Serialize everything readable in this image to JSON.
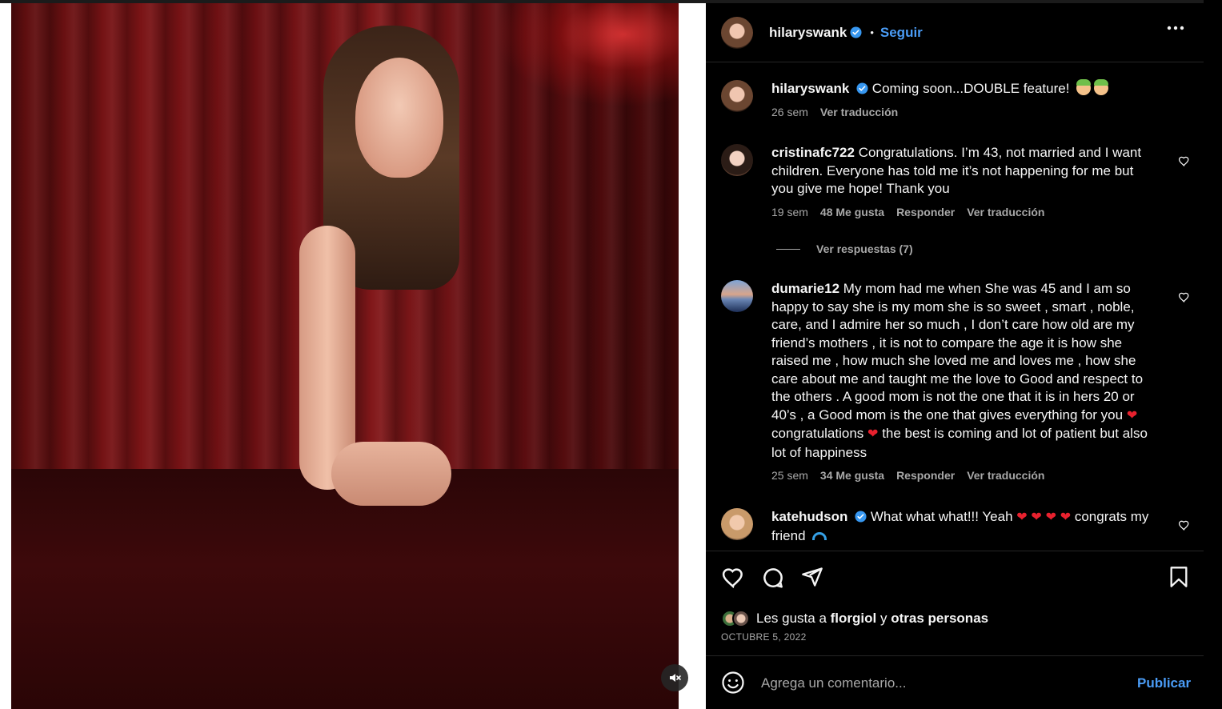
{
  "post": {
    "author": "hilaryswank",
    "follow_label": "Seguir",
    "separator": "•"
  },
  "caption": {
    "username": "hilaryswank",
    "text": "Coming soon...DOUBLE feature!",
    "time": "26 sem",
    "translate": "Ver traducción"
  },
  "comments": [
    {
      "username": "cristinafc722",
      "text": "Congratulations. I’m 43, not married and I want children. Everyone has told me it’s not happening for me but you give me hope! Thank you",
      "time": "19 sem",
      "likes": "48 Me gusta",
      "reply": "Responder",
      "translate": "Ver traducción",
      "view_replies": "Ver respuestas (7)"
    },
    {
      "username": "dumarie12",
      "text_a": "My mom had me when She was 45 and I am so happy to say she is my mom she is so sweet , smart , noble, care, and I admire her so much , I don’t care how old are my friend’s mothers , it is not to compare the age it is how she raised me , how much she loved me and loves me , how she care about me and taught me the love to Good and respect to the others . A good mom is not the one that it is in hers 20 or 40’s , a Good mom is the one that gives everything for you",
      "text_b": "congratulations",
      "text_c": "the best is coming and lot of patient but also lot of happiness",
      "time": "25 sem",
      "likes": "34 Me gusta",
      "reply": "Responder",
      "translate": "Ver traducción"
    },
    {
      "username": "katehudson",
      "text_a": "What what what!!! Yeah",
      "text_b": "congrats my friend"
    }
  ],
  "likes": {
    "prefix": "Les gusta a",
    "user": "florgiol",
    "joiner": "y",
    "others": "otras personas"
  },
  "date": "OCTUBRE 5, 2022",
  "composer": {
    "placeholder": "Agrega un comentario...",
    "publish": "Publicar"
  },
  "colors": {
    "accent": "#4a9cf6",
    "background": "#000000",
    "muted": "#a8a8a8",
    "heart": "#e8212e"
  },
  "icons": [
    "verified-badge-icon",
    "more-options-icon",
    "heart-icon",
    "comment-icon",
    "share-icon",
    "bookmark-icon",
    "emoji-icon",
    "mute-icon"
  ]
}
